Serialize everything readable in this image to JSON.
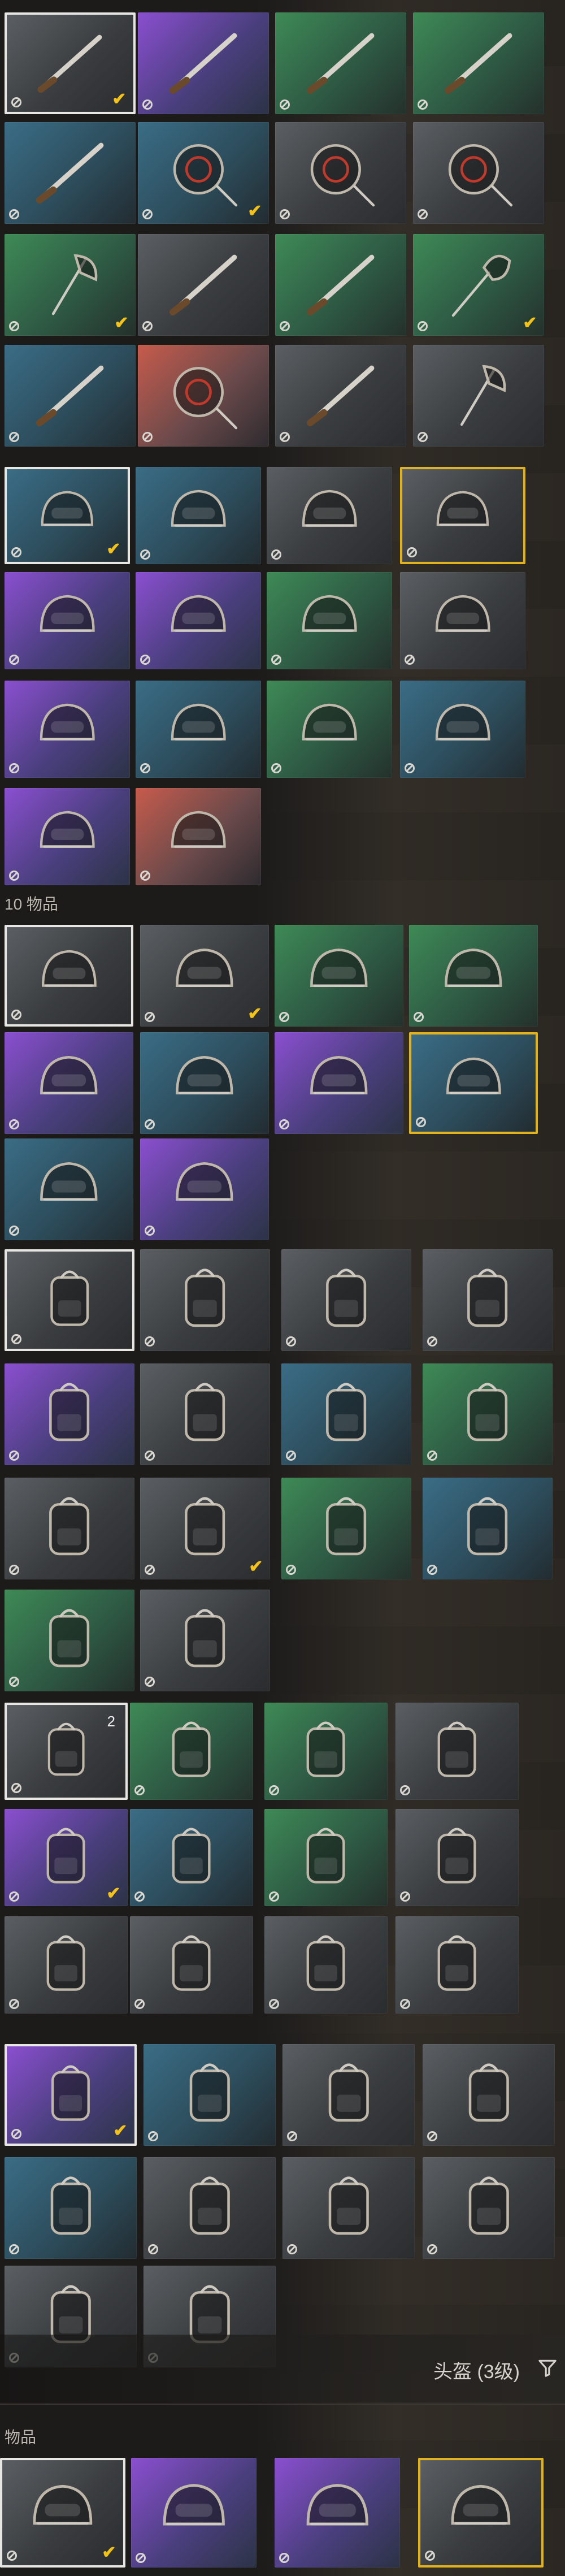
{
  "colors": {
    "selection_white": "#e8e6e2",
    "selection_gold": "#e1b21c",
    "check": "#f2c21b",
    "caption": "#bdb8b0"
  },
  "captions": {
    "helmet_section": "10 物品",
    "items_label": "物品"
  },
  "filter": {
    "label": "头盔 (3级)",
    "icon": "filter-icon"
  },
  "sections": [
    {
      "id": "melee",
      "items": [
        {
          "icon": "machete-icon",
          "bg": "slate",
          "selected": "white",
          "checked": true
        },
        {
          "icon": "sword-icon",
          "bg": "purple",
          "checked": false
        },
        {
          "icon": "cleaver-knife-icon",
          "bg": "green",
          "checked": false
        },
        {
          "icon": "bat-icon",
          "bg": "green",
          "checked": false
        },
        {
          "icon": "kukri-icon",
          "bg": "teal",
          "checked": false
        },
        {
          "icon": "pan-icon",
          "bg": "teal",
          "checked": true
        },
        {
          "icon": "target-pan-icon",
          "bg": "slate",
          "checked": false
        },
        {
          "icon": "ornate-pan-icon",
          "bg": "slate",
          "checked": false
        },
        {
          "icon": "axe-icon",
          "bg": "green",
          "checked": true
        },
        {
          "icon": "cleaver-icon",
          "bg": "slate",
          "checked": false
        },
        {
          "icon": "bat-icon",
          "bg": "green",
          "checked": false
        },
        {
          "icon": "shovel-icon",
          "bg": "green",
          "checked": true
        },
        {
          "icon": "kukri-icon",
          "bg": "teal",
          "checked": false
        },
        {
          "icon": "pan-icon",
          "bg": "red",
          "checked": false
        },
        {
          "icon": "crowbar-icon",
          "bg": "slate",
          "checked": false
        },
        {
          "icon": "axe-icon",
          "bg": "slate",
          "checked": false
        }
      ]
    },
    {
      "id": "helmet-lv3",
      "items": [
        {
          "icon": "motorcycle-helmet-icon",
          "bg": "teal",
          "selected": "white",
          "checked": true
        },
        {
          "icon": "motorcycle-helmet-icon",
          "bg": "teal",
          "checked": false
        },
        {
          "icon": "motorcycle-helmet-icon",
          "bg": "slate",
          "checked": false
        },
        {
          "icon": "motorcycle-helmet-icon",
          "bg": "slate",
          "selected": "gold",
          "checked": false
        },
        {
          "icon": "motorcycle-helmet-icon",
          "bg": "purple",
          "checked": false
        },
        {
          "icon": "viking-helmet-icon",
          "bg": "purple",
          "checked": false
        },
        {
          "icon": "open-helmet-icon",
          "bg": "green",
          "checked": false
        },
        {
          "icon": "spiked-helmet-icon",
          "bg": "slate",
          "checked": false
        },
        {
          "icon": "motorcycle-helmet-icon",
          "bg": "purple",
          "checked": false
        },
        {
          "icon": "motorcycle-helmet-icon",
          "bg": "teal",
          "checked": false
        },
        {
          "icon": "motorcycle-helmet-icon",
          "bg": "green",
          "checked": false
        },
        {
          "icon": "checker-helmet-icon",
          "bg": "teal",
          "checked": false
        },
        {
          "icon": "pilot-helmet-icon",
          "bg": "purple",
          "checked": false
        },
        {
          "icon": "open-helmet-icon",
          "bg": "red",
          "checked": false
        }
      ]
    },
    {
      "id": "helmet-lv1",
      "caption": "10 物品",
      "items": [
        {
          "icon": "army-helmet-icon",
          "bg": "slate",
          "selected": "white",
          "checked": false
        },
        {
          "icon": "army-helmet-icon",
          "bg": "slate",
          "checked": true
        },
        {
          "icon": "army-helmet-icon",
          "bg": "green",
          "checked": false
        },
        {
          "icon": "army-helmet-icon",
          "bg": "green",
          "checked": false
        },
        {
          "icon": "army-helmet-icon",
          "bg": "purple",
          "checked": false
        },
        {
          "icon": "army-helmet-icon",
          "bg": "teal",
          "checked": false
        },
        {
          "icon": "army-helmet-icon",
          "bg": "purple",
          "checked": false
        },
        {
          "icon": "army-helmet-icon",
          "bg": "teal",
          "selected": "gold",
          "checked": false
        },
        {
          "icon": "army-helmet-icon",
          "bg": "teal",
          "checked": false
        },
        {
          "icon": "army-helmet-icon",
          "bg": "purple",
          "checked": false
        }
      ]
    },
    {
      "id": "backpack-a",
      "items": [
        {
          "icon": "backpack-icon",
          "bg": "slate",
          "selected": "white",
          "checked": false
        },
        {
          "icon": "backpack-icon",
          "bg": "slate",
          "checked": false
        },
        {
          "icon": "backpack-icon",
          "bg": "slate",
          "checked": false
        },
        {
          "icon": "backpack-icon",
          "bg": "slate",
          "checked": false
        },
        {
          "icon": "backpack-icon",
          "bg": "purple",
          "checked": false
        },
        {
          "icon": "backpack-icon",
          "bg": "slate",
          "checked": false
        },
        {
          "icon": "backpack-icon",
          "bg": "teal",
          "checked": false
        },
        {
          "icon": "backpack-icon",
          "bg": "green",
          "checked": false
        },
        {
          "icon": "backpack-icon",
          "bg": "slate",
          "checked": false
        },
        {
          "icon": "backpack-icon",
          "bg": "slate",
          "checked": true
        },
        {
          "icon": "backpack-icon",
          "bg": "green",
          "checked": false
        },
        {
          "icon": "backpack-icon",
          "bg": "teal",
          "checked": false
        },
        {
          "icon": "backpack-icon",
          "bg": "green",
          "checked": false
        },
        {
          "icon": "backpack-icon",
          "bg": "slate",
          "checked": false
        }
      ]
    },
    {
      "id": "backpack-b",
      "items": [
        {
          "icon": "backpack-icon",
          "bg": "slate",
          "selected": "white",
          "checked": false,
          "count": "2"
        },
        {
          "icon": "backpack-icon",
          "bg": "green",
          "checked": false
        },
        {
          "icon": "backpack-icon",
          "bg": "green",
          "checked": false
        },
        {
          "icon": "backpack-icon",
          "bg": "slate",
          "checked": false
        },
        {
          "icon": "backpack-icon",
          "bg": "purple",
          "checked": true
        },
        {
          "icon": "backpack-icon",
          "bg": "teal",
          "checked": false
        },
        {
          "icon": "backpack-icon",
          "bg": "green",
          "checked": false
        },
        {
          "icon": "backpack-icon",
          "bg": "slate",
          "checked": false
        },
        {
          "icon": "backpack-icon",
          "bg": "slate",
          "checked": false
        },
        {
          "icon": "backpack-icon",
          "bg": "slate",
          "checked": false
        },
        {
          "icon": "backpack-icon",
          "bg": "slate",
          "checked": false
        },
        {
          "icon": "backpack-icon",
          "bg": "slate",
          "checked": false
        }
      ]
    },
    {
      "id": "backpack-c",
      "items": [
        {
          "icon": "backpack-icon",
          "bg": "purple",
          "selected": "white",
          "checked": true
        },
        {
          "icon": "backpack-icon",
          "bg": "teal",
          "checked": false
        },
        {
          "icon": "backpack-icon",
          "bg": "slate",
          "checked": false
        },
        {
          "icon": "backpack-icon",
          "bg": "slate",
          "checked": false
        },
        {
          "icon": "backpack-icon",
          "bg": "teal",
          "checked": false
        },
        {
          "icon": "backpack-icon",
          "bg": "slate",
          "checked": false
        },
        {
          "icon": "backpack-icon",
          "bg": "slate",
          "checked": false
        },
        {
          "icon": "backpack-icon",
          "bg": "slate",
          "checked": false
        },
        {
          "icon": "backpack-icon",
          "bg": "slate",
          "checked": false
        },
        {
          "icon": "backpack-icon",
          "bg": "slate",
          "checked": false
        }
      ]
    },
    {
      "id": "helmet-lv3-bottom",
      "caption": "物品",
      "items": [
        {
          "icon": "helmet-lv3-icon",
          "bg": "slate",
          "selected": "white",
          "checked": true
        },
        {
          "icon": "helmet-lv3-icon",
          "bg": "purple",
          "checked": false
        },
        {
          "icon": "helmet-lv3-icon",
          "bg": "purple",
          "checked": false
        },
        {
          "icon": "helmet-lv3-icon",
          "bg": "slate",
          "selected": "gold",
          "checked": false
        }
      ]
    }
  ]
}
